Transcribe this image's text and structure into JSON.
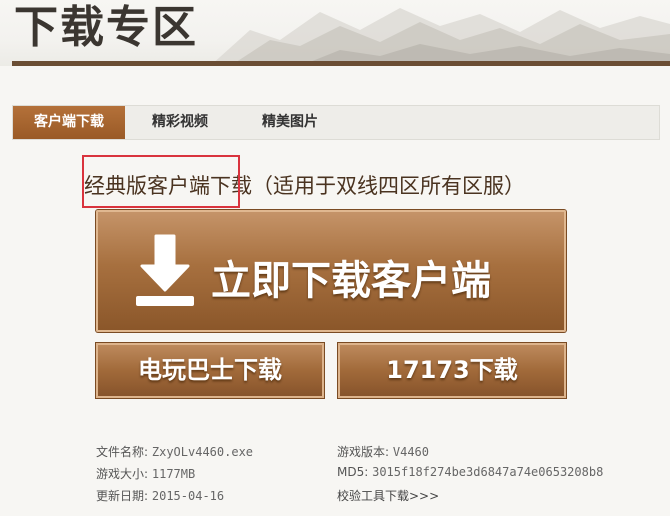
{
  "header": {
    "title": "下载专区"
  },
  "tabs": [
    {
      "label": "客户端下载",
      "active": true
    },
    {
      "label": "精彩视频",
      "active": false
    },
    {
      "label": "精美图片",
      "active": false
    }
  ],
  "download": {
    "subtitle": "经典版客户端下载（适用于双线四区所有区服）",
    "main_button": "立即下载客户端",
    "mirror1": "电玩巴士下载",
    "mirror2": "17173下载"
  },
  "info": {
    "filename_label": "文件名称:",
    "filename_value": "ZxyOLv4460.exe",
    "size_label": "游戏大小:",
    "size_value": "1177MB",
    "date_label": "更新日期:",
    "date_value": "2015-04-16",
    "version_label": "游戏版本:",
    "version_value": "V4460",
    "md5_label": "MD5:",
    "md5_value": "3015f18f274be3d6847a74e0653208b8",
    "verify_link": "校验工具下载>>>"
  },
  "colors": {
    "accent": "#9a5a26",
    "header_rule": "#6b4e34",
    "highlight": "#d9333d"
  },
  "icons": {
    "download": "download-arrow-icon"
  }
}
